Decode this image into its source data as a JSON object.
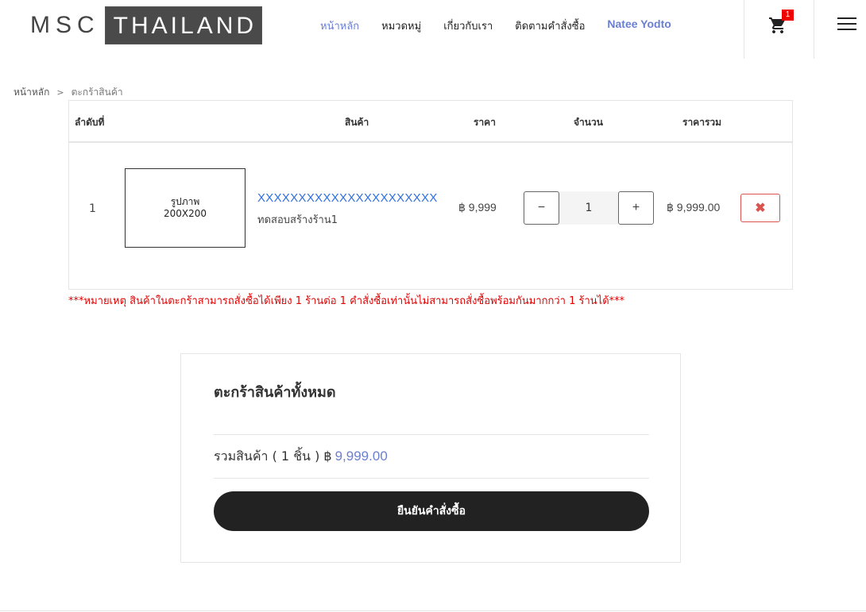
{
  "header": {
    "logo_left": "MSC",
    "logo_right": "THAILAND",
    "nav": [
      {
        "label": "หน้าหลัก"
      },
      {
        "label": "หมวดหมู่"
      },
      {
        "label": "เกี่ยวกับเรา"
      },
      {
        "label": "ติดตามคำสั่งซื้อ"
      },
      {
        "label": "Natee Yodto"
      }
    ],
    "cart_count": "1"
  },
  "breadcrumb": {
    "home": "หน้าหลัก",
    "separator": ">",
    "current": "ตะกร้าสินค้า"
  },
  "cart_table": {
    "headers": {
      "no": "ลำดับที่",
      "product": "สินค้า",
      "price": "ราคา",
      "quantity": "จำนวน",
      "total": "ราคารวม"
    },
    "rows": [
      {
        "no": "1",
        "image_line1": "รูปภาพ",
        "image_line2": "200X200",
        "product_name": "XXXXXXXXXXXXXXXXXXXXXX",
        "shop_name": "ทดสอบสร้างร้าน1",
        "price": "฿ 9,999",
        "qty_minus": "−",
        "qty": "1",
        "qty_plus": "+",
        "subtotal": "฿ 9,999.00",
        "remove": "✖"
      }
    ]
  },
  "note": "***หมายเหตุ สินค้าในตะกร้าสามารถสั่งซื้อได้เพียง 1 ร้านต่อ 1 คำสั่งซื้อเท่านั้นไม่สามารถสั่งซื้อพร้อมกันมากกว่า 1 ร้านได้***",
  "summary": {
    "title": "ตะกร้าสินค้าทั้งหมด",
    "total_label": "รวมสินค้า ( 1 ชิ้น ) ฿",
    "total_amount": "9,999.00",
    "confirm": "ยืนยันคำสั่งซื้อ"
  },
  "colors": {
    "accent": "#6b7fd1",
    "link": "#2f6fe0",
    "danger": "#e00000",
    "button_dark": "#222222"
  }
}
